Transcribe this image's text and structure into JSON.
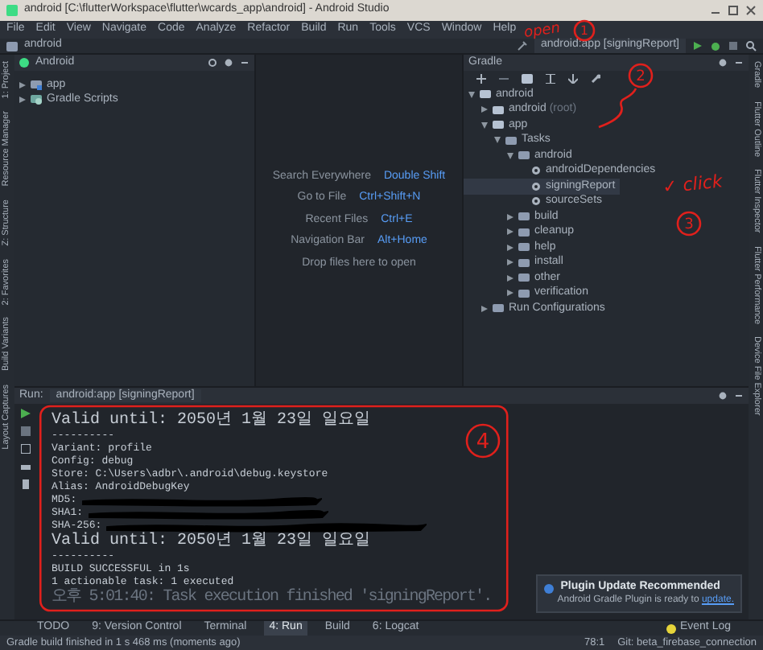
{
  "window": {
    "title": "android [C:\\flutterWorkspace\\flutter\\wcards_app\\android] - Android Studio"
  },
  "menu": [
    "File",
    "Edit",
    "View",
    "Navigate",
    "Code",
    "Analyze",
    "Refactor",
    "Build",
    "Run",
    "Tools",
    "VCS",
    "Window",
    "Help"
  ],
  "navigation_bar": {
    "breadcrumb": "android",
    "run_configuration": "android:app [signingReport]"
  },
  "left_tool_windows": [
    "1: Project",
    "Resource Manager",
    "Z: Structure",
    "2: Favorites",
    "Build Variants",
    "Layout Captures"
  ],
  "right_tool_windows": [
    "Gradle",
    "Flutter Outline",
    "Flutter Inspector",
    "Flutter Performance",
    "Device File Explorer"
  ],
  "project_panel": {
    "view": "Android",
    "tree": [
      {
        "label": "app",
        "kind": "module",
        "expanded": false,
        "selected": false
      },
      {
        "label": "Gradle Scripts",
        "kind": "scripts",
        "expanded": false,
        "selected": false
      }
    ]
  },
  "editor_hints": [
    {
      "action": "Search Everywhere",
      "shortcut": "Double Shift"
    },
    {
      "action": "Go to File",
      "shortcut": "Ctrl+Shift+N"
    },
    {
      "action": "Recent Files",
      "shortcut": "Ctrl+E"
    },
    {
      "action": "Navigation Bar",
      "shortcut": "Alt+Home"
    },
    {
      "action": "Drop files here to open"
    }
  ],
  "gradle_panel": {
    "title": "Gradle",
    "tree": [
      {
        "label": "android",
        "kind": "project",
        "expanded": true,
        "selected": false,
        "children": [
          {
            "label": "android",
            "note": "(root)",
            "kind": "project",
            "expanded": false,
            "selected": false
          },
          {
            "label": "app",
            "kind": "project",
            "expanded": true,
            "selected": false,
            "children": [
              {
                "label": "Tasks",
                "kind": "folder",
                "expanded": true,
                "selected": false,
                "children": [
                  {
                    "label": "android",
                    "kind": "folder",
                    "expanded": true,
                    "selected": false,
                    "children": [
                      {
                        "label": "androidDependencies",
                        "kind": "task",
                        "selected": false
                      },
                      {
                        "label": "signingReport",
                        "kind": "task",
                        "selected": true
                      },
                      {
                        "label": "sourceSets",
                        "kind": "task",
                        "selected": false
                      }
                    ]
                  },
                  {
                    "label": "build",
                    "kind": "folder",
                    "expanded": false,
                    "selected": false
                  },
                  {
                    "label": "cleanup",
                    "kind": "folder",
                    "expanded": false,
                    "selected": false
                  },
                  {
                    "label": "help",
                    "kind": "folder",
                    "expanded": false,
                    "selected": false
                  },
                  {
                    "label": "install",
                    "kind": "folder",
                    "expanded": false,
                    "selected": false
                  },
                  {
                    "label": "other",
                    "kind": "folder",
                    "expanded": false,
                    "selected": false
                  },
                  {
                    "label": "verification",
                    "kind": "folder",
                    "expanded": false,
                    "selected": false
                  }
                ]
              }
            ]
          },
          {
            "label": "Run Configurations",
            "kind": "folder",
            "expanded": false,
            "selected": false
          }
        ]
      }
    ]
  },
  "run_panel": {
    "label": "Run:",
    "tab": "android:app [signingReport]",
    "lines": [
      {
        "text": "Valid until: 2050년 1월 23일 일요일",
        "kind": "output"
      },
      {
        "text": "----------",
        "kind": "output"
      },
      {
        "text": "Variant: profile",
        "kind": "output"
      },
      {
        "text": "Config: debug",
        "kind": "output"
      },
      {
        "text": "Store: C:\\Users\\adbr\\.android\\debug.keystore",
        "kind": "output"
      },
      {
        "text": "Alias: AndroidDebugKey",
        "kind": "output"
      },
      {
        "text": "MD5:",
        "kind": "output",
        "redacted": true
      },
      {
        "text": "SHA1:",
        "kind": "output",
        "redacted": true
      },
      {
        "text": "SHA-256:",
        "kind": "output",
        "redacted": true
      },
      {
        "text": "Valid until: 2050년 1월 23일 일요일",
        "kind": "output"
      },
      {
        "text": "----------",
        "kind": "output"
      },
      {
        "text": "BUILD SUCCESSFUL in 1s",
        "kind": "output"
      },
      {
        "text": "1 actionable task: 1 executed",
        "kind": "output"
      },
      {
        "text": "오후 5:01:40: Task execution finished 'signingReport'.",
        "kind": "info"
      }
    ]
  },
  "notification": {
    "title": "Plugin Update Recommended",
    "message": "Android Gradle Plugin is ready to",
    "link": "update."
  },
  "tool_tabs": [
    {
      "label": "TODO",
      "selected": false
    },
    {
      "label": "9: Version Control",
      "selected": false
    },
    {
      "label": "Terminal",
      "selected": false
    },
    {
      "label": "4: Run",
      "selected": true
    },
    {
      "label": "Build",
      "selected": false
    },
    {
      "label": "6: Logcat",
      "selected": false
    }
  ],
  "event_log": "Event Log",
  "status_bar": {
    "message": "Gradle build finished in 1 s 468 ms (moments ago)",
    "position": "78:1",
    "branch": "Git: beta_firebase_connection"
  },
  "annotations": [
    {
      "kind": "label",
      "text": "open"
    },
    {
      "kind": "circled",
      "text": "1"
    },
    {
      "kind": "circled",
      "text": "2"
    },
    {
      "kind": "arrow"
    },
    {
      "kind": "label",
      "text": "✓ click"
    },
    {
      "kind": "circled",
      "text": "3"
    },
    {
      "kind": "circled",
      "text": "4"
    },
    {
      "kind": "ellipse"
    }
  ]
}
